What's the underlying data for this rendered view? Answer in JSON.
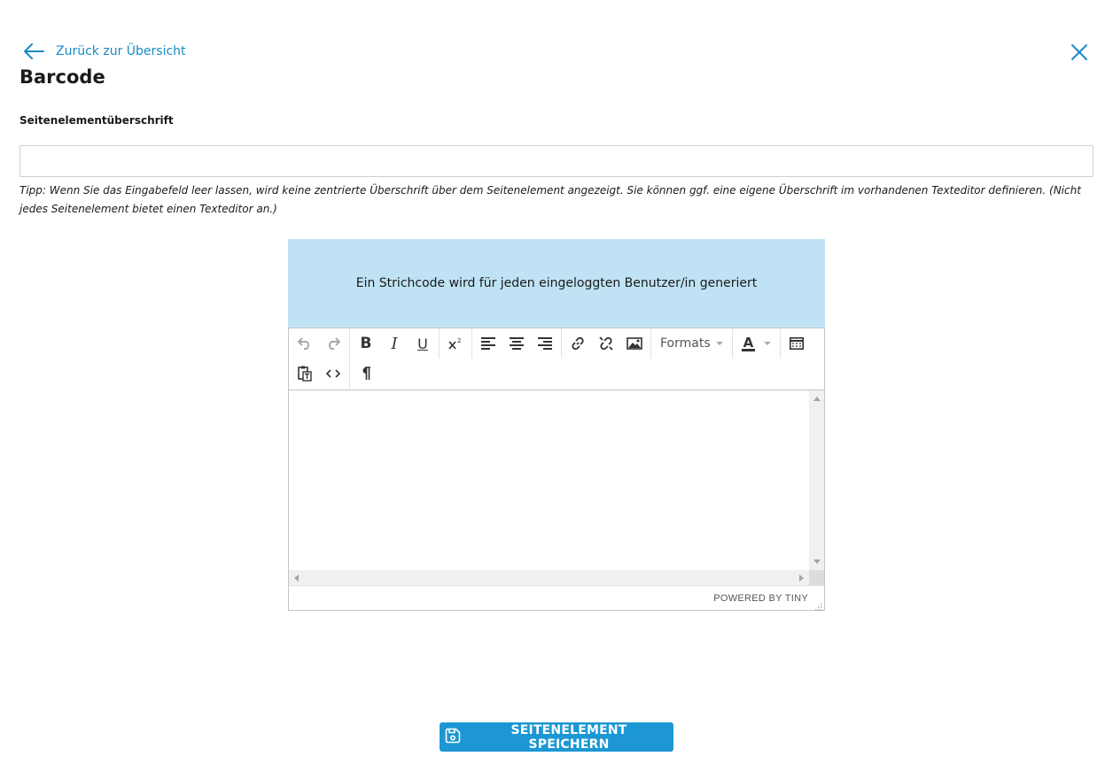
{
  "nav": {
    "back_label": "Zurück zur Übersicht"
  },
  "page": {
    "title": "Barcode"
  },
  "form": {
    "heading_label": "Seitenelementüberschrift",
    "heading_value": "",
    "hint": "Tipp: Wenn Sie das Eingabefeld leer lassen, wird keine zentrierte Überschrift über dem Seitenelement angezeigt. Sie können ggf. eine eigene Überschrift im vorhandenen Texteditor definieren. (Nicht jedes Seitenelement bietet einen Texteditor an.)"
  },
  "info_box": {
    "text": "Ein Strichcode wird für jeden eingeloggten Benutzer/in generiert",
    "color": "#bfe3f4"
  },
  "editor": {
    "formats_label": "Formats",
    "powered_by": "POWERED BY TINY",
    "content": "",
    "toolbar_icons": [
      "undo-icon",
      "redo-icon",
      "bold-icon",
      "italic-icon",
      "underline-icon",
      "superscript-icon",
      "align-left-icon",
      "align-center-icon",
      "align-right-icon",
      "link-icon",
      "unlink-icon",
      "image-icon",
      "formats-dropdown",
      "text-color-icon",
      "table-icon",
      "paste-text-icon",
      "source-code-icon",
      "paragraph-icon"
    ]
  },
  "actions": {
    "save_label": "SEITENELEMENT SPEICHERN"
  },
  "colors": {
    "accent": "#1c97d4",
    "link": "#1a8ac7"
  }
}
